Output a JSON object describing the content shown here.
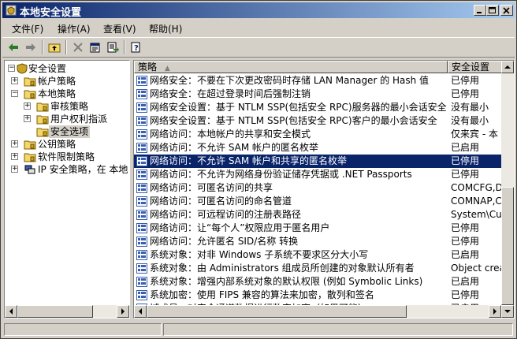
{
  "window": {
    "title": "本地安全设置",
    "title_bar_color": "#0a246a"
  },
  "menubar": [
    {
      "label": "文件(F)"
    },
    {
      "label": "操作(A)"
    },
    {
      "label": "查看(V)"
    },
    {
      "label": "帮助(H)"
    }
  ],
  "toolbar": {
    "icons": [
      "back-icon",
      "forward-icon",
      "up-folder-icon",
      "delete-icon",
      "properties-icon",
      "export-icon",
      "help-icon"
    ]
  },
  "tree": {
    "items": [
      {
        "label": "安全设置",
        "expander": "−"
      },
      {
        "label": "帐户策略",
        "expander": "+"
      },
      {
        "label": "本地策略",
        "expander": "−"
      },
      {
        "label": "审核策略",
        "expander": "+"
      },
      {
        "label": "用户权利指派",
        "expander": "+"
      },
      {
        "label": "安全选项",
        "expander": ""
      },
      {
        "label": "公钥策略",
        "expander": "+"
      },
      {
        "label": "软件限制策略",
        "expander": "+"
      },
      {
        "label": "IP 安全策略，在 本地",
        "expander": "+"
      }
    ],
    "selected": "安全选项"
  },
  "list": {
    "columns": {
      "policy": "策略",
      "setting": "安全设置"
    },
    "rows": [
      {
        "name": "网络安全：不要在下次更改密码时存储 LAN Manager 的 Hash 值",
        "value": "已停用"
      },
      {
        "name": "网络安全：在超过登录时间后强制注销",
        "value": "已停用"
      },
      {
        "name": "网络安全设置：基于 NTLM SSP(包括安全 RPC)服务器的最小会话安全",
        "value": "没有最小"
      },
      {
        "name": "网络安全设置：基于 NTLM SSP(包括安全 RPC)客户的最小会话安全",
        "value": "没有最小"
      },
      {
        "name": "网络访问：本地帐户的共享和安全模式",
        "value": "仅来宾 - 本"
      },
      {
        "name": "网络访问：不允许 SAM 帐户的匿名枚举",
        "value": "已启用"
      },
      {
        "name": "网络访问：不允许 SAM 帐户和共享的匿名枚举",
        "value": "已停用"
      },
      {
        "name": "网络访问：不允许为网络身份验证储存凭据或 .NET Passports",
        "value": "已停用"
      },
      {
        "name": "网络访问：可匿名访问的共享",
        "value": "COMCFG,DFS$"
      },
      {
        "name": "网络访问：可匿名访问的命名管道",
        "value": "COMNAP,COMN"
      },
      {
        "name": "网络访问：可远程访问的注册表路径",
        "value": "System\\Curr"
      },
      {
        "name": "网络访问：让“每个人”权限应用于匿名用户",
        "value": "已停用"
      },
      {
        "name": "网络访问：允许匿名 SID/名称 转换",
        "value": "已停用"
      },
      {
        "name": "系统对象：对非 Windows 子系统不要求区分大小写",
        "value": "已启用"
      },
      {
        "name": "系统对象：由 Administrators 组成员所创建的对象默认所有者",
        "value": "Object crea"
      },
      {
        "name": "系统对象：增强内部系统对象的默认权限 (例如 Symbolic Links)",
        "value": "已启用"
      },
      {
        "name": "系统加密：使用 FIPS 兼容的算法来加密，散列和签名",
        "value": "已停用"
      },
      {
        "name": "域成员：对安全通道数据进行数字加密（如果可能）",
        "value": "已启用"
      }
    ],
    "selected_index": 6
  },
  "colors": {
    "selection": "#0a246a",
    "policy_icon": "#3a5fb0"
  }
}
